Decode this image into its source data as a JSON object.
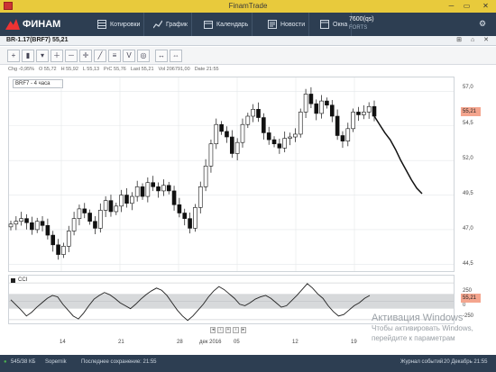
{
  "app": {
    "title": "FinamTrade"
  },
  "toolbar": {
    "logo": "ФИНАМ",
    "quotes": "Котировки",
    "chart": "График",
    "calendar": "Календарь",
    "news": "Новости",
    "windows": "Окна",
    "server_line1": "7600(qs)",
    "server_line2": "FORTS"
  },
  "chart_window": {
    "title": "BR-1.17(BRF7) 55,21",
    "window_controls": "⊞ ⌂ ✕"
  },
  "info": {
    "chg": "Chg -0,95%",
    "o": "O 55,72",
    "h": "H 55,92",
    "l": "L 55,13",
    "prc": "PrC 55,76",
    "last": "Last 55,21",
    "vol": "Vol 206791,00",
    "date": "Date 21:55"
  },
  "instrument_selector": "BRF7 - 4 часа",
  "price_label": "55,21",
  "cci_label": "CCI",
  "cci_value": "55,21",
  "y_ticks": [
    "57,0",
    "54,5",
    "52,0",
    "49,5",
    "47,0",
    "44,5"
  ],
  "cci_ticks": [
    "250",
    "0",
    "-250"
  ],
  "x_ticks": [
    "14",
    "21",
    "28",
    "дек 2016",
    "05",
    "12",
    "19"
  ],
  "watermark": {
    "line1": "Активация Windows",
    "line2": "Чтобы активировать Windows,",
    "line3": "перейдите к параметрам"
  },
  "status": {
    "traffic": "545/38 КБ",
    "mode": "Sopernik",
    "saved": "Последнее сохранение: 21:55",
    "journal": "Журнал событий",
    "datetime": "20 Декабрь 21:55"
  },
  "colors": {
    "toolbar_bg": "#2d3e52",
    "title_bar": "#e8ca3c",
    "accent": "#f4a58e"
  },
  "chart_data": [
    {
      "type": "candlestick",
      "title": "BR-1.17(BRF7) 55,21",
      "timeframe": "4 часа",
      "x_labels": [
        "14",
        "21",
        "28",
        "дек 2016",
        "05",
        "12",
        "19"
      ],
      "ylim": [
        44,
        58
      ],
      "y_ticks": [
        57.0,
        54.5,
        52.0,
        49.5,
        47.0,
        44.5
      ],
      "last_price": 55.21,
      "closes": [
        47.4,
        47.6,
        47.8,
        47.5,
        47.0,
        47.6,
        47.3,
        46.6,
        45.9,
        45.2,
        45.8,
        46.9,
        47.8,
        48.5,
        48.2,
        47.6,
        47.1,
        48.4,
        49.1,
        48.3,
        48.7,
        49.5,
        48.9,
        49.4,
        50.1,
        49.4,
        50.4,
        50.1,
        49.8,
        50.2,
        49.8,
        48.8,
        48.2,
        47.8,
        47.1,
        48.6,
        50.1,
        51.6,
        53.2,
        54.6,
        54.1,
        53.7,
        52.5,
        53.3,
        54.6,
        55.2,
        55.7,
        55.1,
        54.0,
        53.5,
        53.2,
        52.9,
        53.6,
        53.7,
        53.9,
        55.5,
        56.8,
        56.1,
        55.4,
        56.3,
        56.0,
        55.2,
        53.8,
        53.4,
        54.3,
        55.5,
        55.3,
        55.5,
        55.9,
        55.2
      ],
      "projection": [
        55.21,
        54.6,
        54.0,
        53.5,
        52.8,
        52.0,
        51.3,
        50.6,
        50.0,
        49.6
      ]
    },
    {
      "type": "line",
      "title": "CCI",
      "ylim": [
        -300,
        300
      ],
      "y_ticks": [
        250,
        0,
        -250
      ],
      "values": [
        20,
        -50,
        -120,
        -200,
        -150,
        -80,
        -20,
        40,
        80,
        60,
        -40,
        -120,
        -200,
        -240,
        -160,
        -60,
        30,
        80,
        120,
        90,
        40,
        -20,
        -60,
        -100,
        -40,
        30,
        90,
        140,
        180,
        150,
        80,
        -20,
        -120,
        -200,
        -260,
        -200,
        -120,
        -40,
        60,
        140,
        200,
        160,
        100,
        40,
        -40,
        -60,
        -20,
        30,
        60,
        80,
        40,
        -20,
        -80,
        -60,
        10,
        80,
        160,
        240,
        180,
        100,
        40,
        -60,
        -140,
        -200,
        -180,
        -120,
        -60,
        -20,
        40,
        80
      ]
    }
  ]
}
